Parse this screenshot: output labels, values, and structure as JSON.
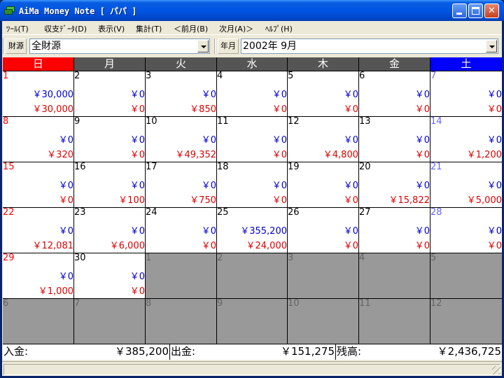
{
  "window": {
    "title": "AiMa Money Note [ パパ ]"
  },
  "menu": [
    "ﾂｰﾙ(T)",
    "収支ﾃﾞｰﾀ(D)",
    "表示(V)",
    "集計(T)",
    "＜前月(B)",
    "次月(A)＞",
    "ﾍﾙﾌﾟ(H)"
  ],
  "toolbar": {
    "source_label": "財源",
    "source_value": "全財源",
    "month_label": "年月",
    "month_value": "2002年  9月"
  },
  "calendar": {
    "weekdays": [
      "日",
      "月",
      "火",
      "水",
      "木",
      "金",
      "土"
    ],
    "weekday_colors": [
      "#ff0000",
      "#555555",
      "#555555",
      "#555555",
      "#555555",
      "#555555",
      "#0000ff"
    ],
    "weeks": [
      [
        {
          "day": "1",
          "in": "￥30,000",
          "out": "￥30,000"
        },
        {
          "day": "2",
          "in": "￥0",
          "out": "￥0"
        },
        {
          "day": "3",
          "in": "￥0",
          "out": "￥850"
        },
        {
          "day": "4",
          "in": "￥0",
          "out": "￥0"
        },
        {
          "day": "5",
          "in": "￥0",
          "out": "￥0"
        },
        {
          "day": "6",
          "in": "￥0",
          "out": "￥0"
        },
        {
          "day": "7",
          "in": "￥0",
          "out": "￥0"
        }
      ],
      [
        {
          "day": "8",
          "in": "￥0",
          "out": "￥320"
        },
        {
          "day": "9",
          "in": "￥0",
          "out": "￥0"
        },
        {
          "day": "10",
          "in": "￥0",
          "out": "￥49,352"
        },
        {
          "day": "11",
          "in": "￥0",
          "out": "￥0"
        },
        {
          "day": "12",
          "in": "￥0",
          "out": "￥4,800"
        },
        {
          "day": "13",
          "in": "￥0",
          "out": "￥0"
        },
        {
          "day": "14",
          "in": "￥0",
          "out": "￥1,200"
        }
      ],
      [
        {
          "day": "15",
          "in": "￥0",
          "out": "￥0"
        },
        {
          "day": "16",
          "in": "￥0",
          "out": "￥100"
        },
        {
          "day": "17",
          "in": "￥0",
          "out": "￥750"
        },
        {
          "day": "18",
          "in": "￥0",
          "out": "￥0"
        },
        {
          "day": "19",
          "in": "￥0",
          "out": "￥0"
        },
        {
          "day": "20",
          "in": "￥0",
          "out": "￥15,822"
        },
        {
          "day": "21",
          "in": "￥0",
          "out": "￥5,000"
        }
      ],
      [
        {
          "day": "22",
          "in": "￥0",
          "out": "￥12,081"
        },
        {
          "day": "23",
          "in": "￥0",
          "out": "￥6,000"
        },
        {
          "day": "24",
          "in": "￥0",
          "out": "￥0"
        },
        {
          "day": "25",
          "in": "￥355,200",
          "out": "￥24,000"
        },
        {
          "day": "26",
          "in": "￥0",
          "out": "￥0"
        },
        {
          "day": "27",
          "in": "￥0",
          "out": "￥0"
        },
        {
          "day": "28",
          "in": "￥0",
          "out": "￥0"
        }
      ],
      [
        {
          "day": "29",
          "in": "￥0",
          "out": "￥1,000"
        },
        {
          "day": "30",
          "in": "￥0",
          "out": "￥0"
        },
        {
          "day": "1",
          "other": true
        },
        {
          "day": "2",
          "other": true
        },
        {
          "day": "3",
          "other": true
        },
        {
          "day": "4",
          "other": true
        },
        {
          "day": "5",
          "other": true
        }
      ],
      [
        {
          "day": "6",
          "other": true
        },
        {
          "day": "7",
          "other": true
        },
        {
          "day": "8",
          "other": true
        },
        {
          "day": "9",
          "other": true
        },
        {
          "day": "10",
          "other": true
        },
        {
          "day": "11",
          "other": true
        },
        {
          "day": "12",
          "other": true
        }
      ]
    ]
  },
  "totals": {
    "income_label": "入金:",
    "income_value": "￥385,200",
    "expense_label": "出金:",
    "expense_value": "￥151,275",
    "balance_label": "残高:",
    "balance_value": "￥2,436,725"
  },
  "colors": {
    "sunday": "#ff0000",
    "saturday": "#6666ff",
    "income": "#0000cc",
    "expense": "#dd0000"
  }
}
